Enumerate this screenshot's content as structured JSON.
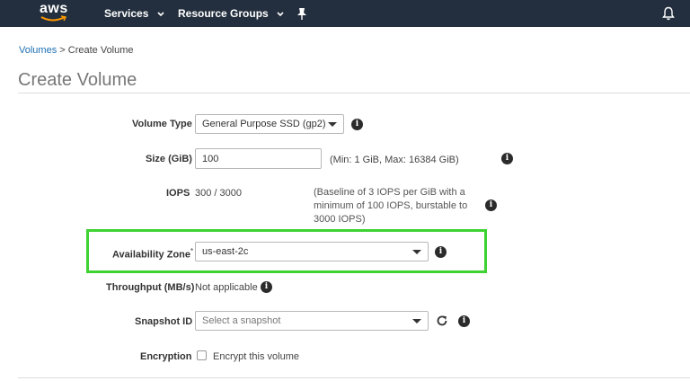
{
  "nav": {
    "logo_text": "aws",
    "services_label": "Services",
    "resource_groups_label": "Resource Groups"
  },
  "breadcrumb": {
    "volumes_link": "Volumes",
    "separator": ">",
    "current": "Create Volume"
  },
  "page_title": "Create Volume",
  "form": {
    "volume_type": {
      "label": "Volume Type",
      "value": "General Purpose SSD (gp2)"
    },
    "size": {
      "label": "Size (GiB)",
      "value": "100",
      "hint": "(Min: 1 GiB, Max: 16384 GiB)"
    },
    "iops": {
      "label": "IOPS",
      "value": "300 / 3000",
      "hint_line1": "(Baseline of 3 IOPS per GiB with a",
      "hint_line2": "minimum of 100 IOPS, burstable to",
      "hint_line3": "3000 IOPS)"
    },
    "availability_zone": {
      "label": "Availability Zone",
      "required_mark": "*",
      "value": "us-east-2c"
    },
    "throughput": {
      "label": "Throughput (MB/s)",
      "value": "Not applicable"
    },
    "snapshot": {
      "label": "Snapshot ID",
      "placeholder": "Select a snapshot"
    },
    "encryption": {
      "label": "Encryption",
      "checkbox_label": "Encrypt this volume",
      "checked": false
    }
  },
  "icons": {
    "info": "info-icon",
    "refresh": "refresh-icon",
    "pin": "pin-icon",
    "bell": "bell-icon"
  },
  "colors": {
    "nav_bg": "#232f3e",
    "link": "#1f6fb4",
    "highlight": "#3ed233"
  }
}
